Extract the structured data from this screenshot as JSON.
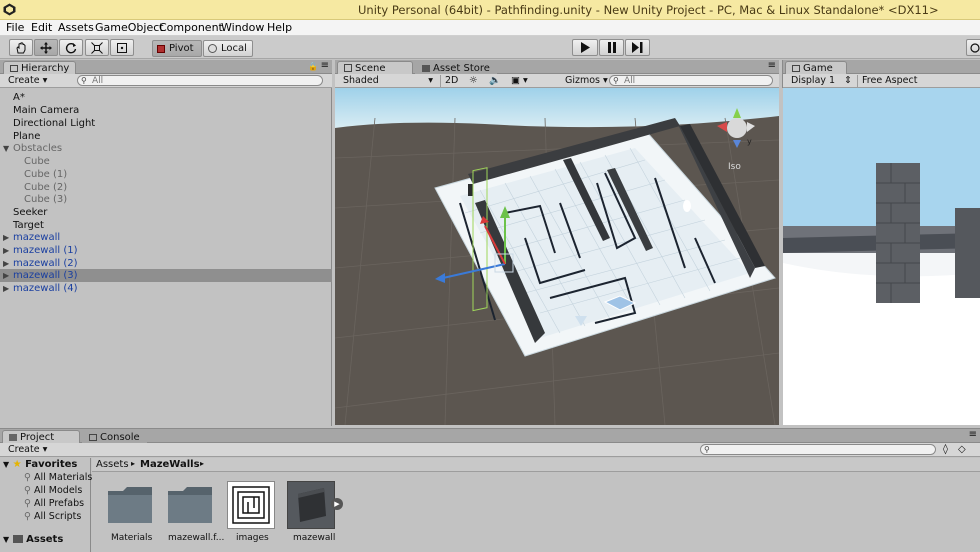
{
  "window": {
    "title": "Unity Personal (64bit) - Pathfinding.unity - New Unity Project - PC, Mac & Linux Standalone* <DX11>"
  },
  "menu": [
    "File",
    "Edit",
    "Assets",
    "GameObject",
    "Component",
    "Window",
    "Help"
  ],
  "toolbar": {
    "pivot_label": "Pivot",
    "local_label": "Local",
    "tools": [
      "hand-tool",
      "move-tool",
      "rotate-tool",
      "scale-tool",
      "rect-tool"
    ],
    "play_controls": [
      "play",
      "pause",
      "step"
    ]
  },
  "hierarchy": {
    "tab_label": "Hierarchy",
    "create_label": "Create",
    "search_placeholder": "All",
    "items": [
      {
        "label": "A*",
        "style": "normal"
      },
      {
        "label": "Main Camera",
        "style": "normal"
      },
      {
        "label": "Directional Light",
        "style": "normal"
      },
      {
        "label": "Plane",
        "style": "normal"
      },
      {
        "label": "Obstacles",
        "style": "grey"
      },
      {
        "label": "Cube",
        "style": "grey-child"
      },
      {
        "label": "Cube (1)",
        "style": "grey-child"
      },
      {
        "label": "Cube (2)",
        "style": "grey-child"
      },
      {
        "label": "Cube (3)",
        "style": "grey-child"
      },
      {
        "label": "Seeker",
        "style": "normal"
      },
      {
        "label": "Target",
        "style": "normal"
      },
      {
        "label": "mazewall",
        "style": "blue"
      },
      {
        "label": "mazewall (1)",
        "style": "blue"
      },
      {
        "label": "mazewall (2)",
        "style": "blue"
      },
      {
        "label": "mazewall (3)",
        "style": "blue-selected"
      },
      {
        "label": "mazewall (4)",
        "style": "blue"
      }
    ]
  },
  "scene": {
    "tab_label": "Scene",
    "asset_store_label": "Asset Store",
    "shading_label": "Shaded",
    "mode_2d_label": "2D",
    "gizmos_label": "Gizmos",
    "search_placeholder": "All",
    "iso_label": "Iso"
  },
  "game": {
    "tab_label": "Game",
    "display_label": "Display 1",
    "aspect_label": "Free Aspect"
  },
  "project": {
    "tab_label": "Project",
    "console_tab_label": "Console",
    "create_label": "Create",
    "favorites_label": "Favorites",
    "favorites": [
      "All Materials",
      "All Models",
      "All Prefabs",
      "All Scripts"
    ],
    "assets_label": "Assets",
    "breadcrumb": [
      "Assets",
      "MazeWalls"
    ],
    "assets": [
      "Materials",
      "mazewall.f...",
      "images",
      "mazewall"
    ]
  },
  "colors": {
    "title_bar": "#f6e9a2",
    "selection": "#8f8f8f",
    "prefab_blue": "#1a3fa0",
    "panel": "#c2c2c2"
  }
}
